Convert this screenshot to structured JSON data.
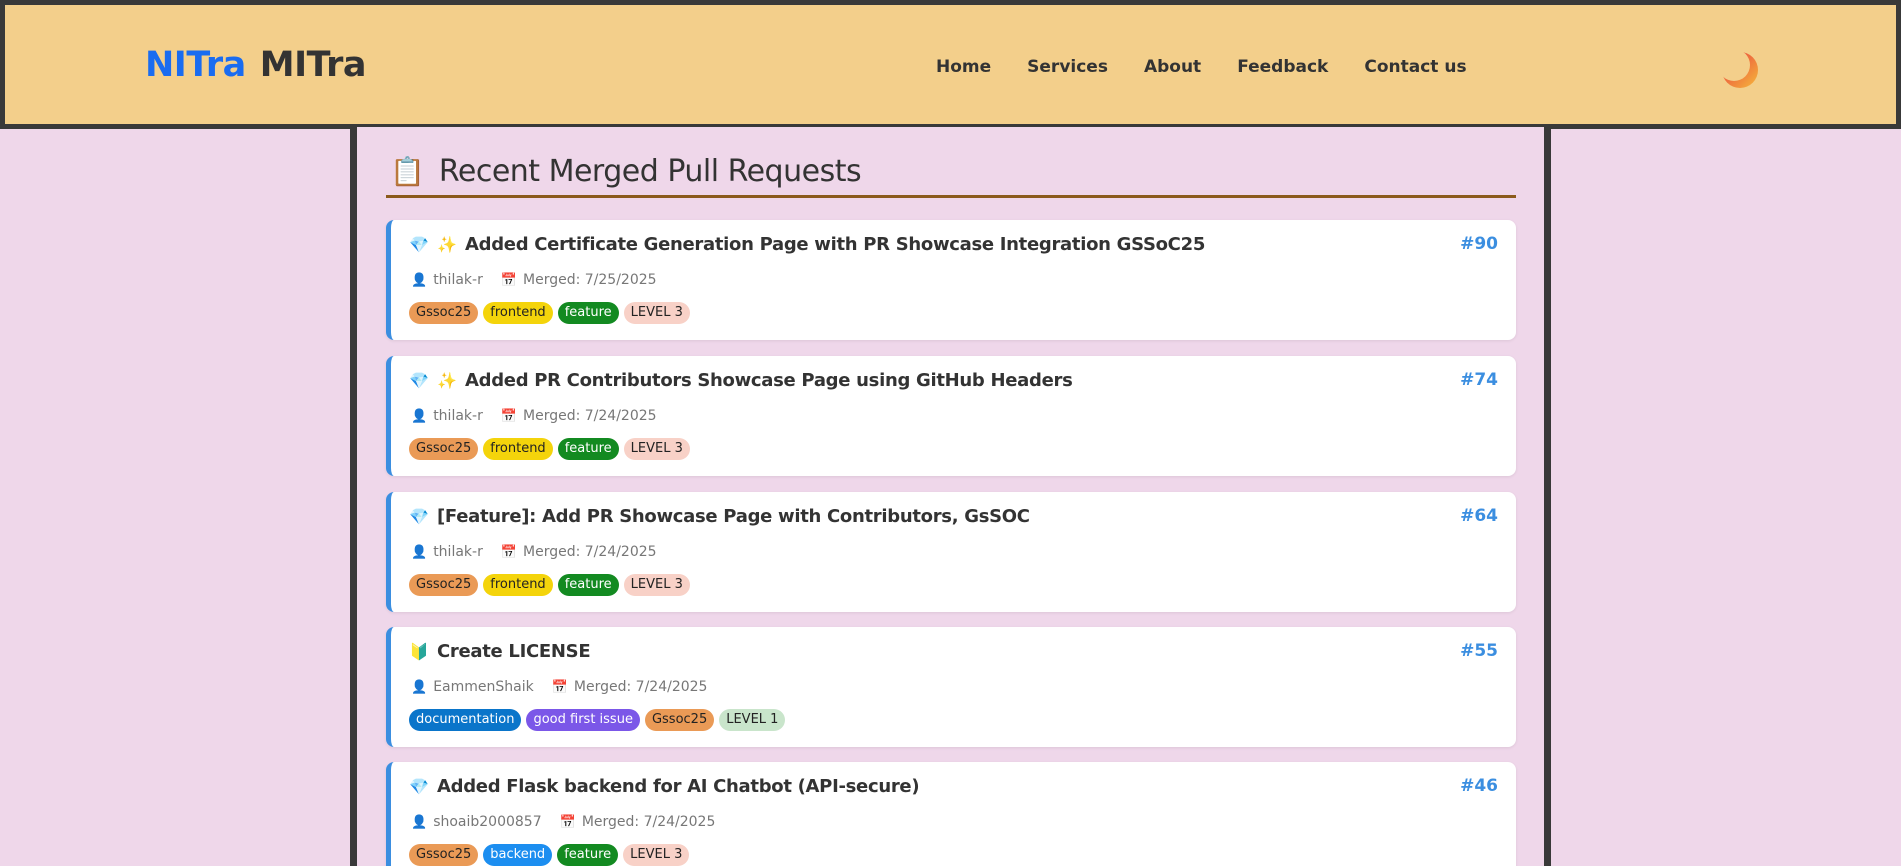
{
  "brand": {
    "part1": "NITra",
    "part2": "MITra"
  },
  "nav": {
    "items": [
      "Home",
      "Services",
      "About",
      "Feedback",
      "Contact us"
    ]
  },
  "theme_toggle": {
    "icon": "moon-icon"
  },
  "page": {
    "emoji": "📋",
    "title": "Recent Merged Pull Requests"
  },
  "prs": [
    {
      "glyphs": [
        "💎",
        "✨"
      ],
      "title": "Added Certificate Generation Page with PR Showcase Integration GSSoC25",
      "number": "#90",
      "author": "thilak-r",
      "merged": "Merged: 7/25/2025",
      "labels": [
        {
          "text": "Gssoc25",
          "bg": "#ea9a56",
          "fg": "#222222"
        },
        {
          "text": "frontend",
          "bg": "#f4d40b",
          "fg": "#222222"
        },
        {
          "text": "feature",
          "bg": "#138a21",
          "fg": "#ffffff"
        },
        {
          "text": "LEVEL 3",
          "bg": "#f8d1c7",
          "fg": "#222222"
        }
      ]
    },
    {
      "glyphs": [
        "💎",
        "✨"
      ],
      "title": "Added PR Contributors Showcase Page using GitHub Headers",
      "number": "#74",
      "author": "thilak-r",
      "merged": "Merged: 7/24/2025",
      "labels": [
        {
          "text": "Gssoc25",
          "bg": "#ea9a56",
          "fg": "#222222"
        },
        {
          "text": "frontend",
          "bg": "#f4d40b",
          "fg": "#222222"
        },
        {
          "text": "feature",
          "bg": "#138a21",
          "fg": "#ffffff"
        },
        {
          "text": "LEVEL 3",
          "bg": "#f8d1c7",
          "fg": "#222222"
        }
      ]
    },
    {
      "glyphs": [
        "💎"
      ],
      "title": "[Feature]: Add PR Showcase Page with Contributors, GsSOC",
      "number": "#64",
      "author": "thilak-r",
      "merged": "Merged: 7/24/2025",
      "labels": [
        {
          "text": "Gssoc25",
          "bg": "#ea9a56",
          "fg": "#222222"
        },
        {
          "text": "frontend",
          "bg": "#f4d40b",
          "fg": "#222222"
        },
        {
          "text": "feature",
          "bg": "#138a21",
          "fg": "#ffffff"
        },
        {
          "text": "LEVEL 3",
          "bg": "#f8d1c7",
          "fg": "#222222"
        }
      ]
    },
    {
      "glyphs": [
        "🔰"
      ],
      "title": "Create LICENSE",
      "number": "#55",
      "author": "EammenShaik",
      "merged": "Merged: 7/24/2025",
      "labels": [
        {
          "text": "documentation",
          "bg": "#0a75ca",
          "fg": "#ffffff"
        },
        {
          "text": "good first issue",
          "bg": "#7b57e8",
          "fg": "#ffffff"
        },
        {
          "text": "Gssoc25",
          "bg": "#ea9a56",
          "fg": "#222222"
        },
        {
          "text": "LEVEL 1",
          "bg": "#c9e5cb",
          "fg": "#222222"
        }
      ]
    },
    {
      "glyphs": [
        "💎"
      ],
      "title": "Added Flask backend for AI Chatbot (API-secure)",
      "number": "#46",
      "author": "shoaib2000857",
      "merged": "Merged: 7/24/2025",
      "labels": [
        {
          "text": "Gssoc25",
          "bg": "#ea9a56",
          "fg": "#222222"
        },
        {
          "text": "backend",
          "bg": "#1c8ef0",
          "fg": "#ffffff"
        },
        {
          "text": "feature",
          "bg": "#138a21",
          "fg": "#ffffff"
        },
        {
          "text": "LEVEL 3",
          "bg": "#f8d1c7",
          "fg": "#222222"
        }
      ]
    }
  ]
}
